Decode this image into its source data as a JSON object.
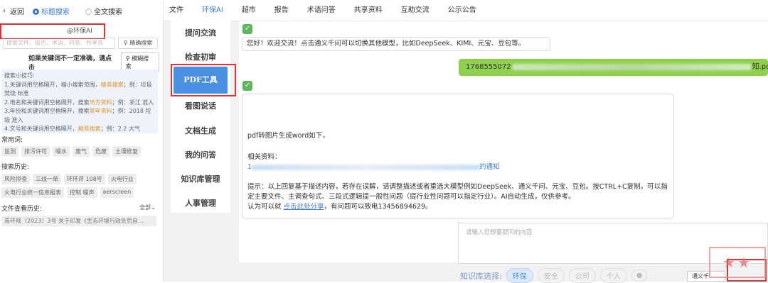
{
  "left_panel": {
    "back_label": "返回",
    "title_search_label": "标题搜索",
    "fulltext_search_label": "全文搜索",
    "keyword_box_text": "@环保AI",
    "search_placeholder": "搜索文件、报告、术语、问答、共享资",
    "precise_search_label": "精确搜索",
    "fuzzy_prompt": "如果关键词不一定准确，请点击",
    "fuzzy_search_label": "模糊搜索",
    "tips": {
      "title": "搜索小技巧:",
      "line1a": "1.关键词用空格隔开，缩小搜索范围，",
      "line1hl": "精准搜索",
      "line1b": "；例：垃圾 焚烧 标准",
      "line2a": "2.地名和关键词用空格隔开，搜索",
      "line2hl": "地方资料",
      "line2b": "；例：浙江 准入",
      "line3a": "3.年份和关键词用空格隔开，搜索",
      "line3hl": "某年资料",
      "line3b": "；例：2018 垃圾 准入",
      "line4a": "4.文号和关键词用空格隔开，",
      "line4hl": "精准搜索",
      "line4b": "；例：2.2 大气"
    },
    "common_words_label": "常用词:",
    "common_words": [
      "监测",
      "排污许可",
      "噪水",
      "废气",
      "危废",
      "土壤修复"
    ],
    "search_history_label": "搜索历史:",
    "search_history": [
      "风险排查",
      "三线一单",
      "环环评 108号",
      "火电行业",
      "火电行业统一信息报表",
      "控制 噪声",
      "aerscreen"
    ],
    "file_history_label": "文件查看历史:",
    "all_label": "全部",
    "file_history_item": "青环规〔2023〕3号 关于印发《生态环境行政处罚自..."
  },
  "nav": {
    "items": [
      "文件",
      "环保AI",
      "超市",
      "报告",
      "术语问答",
      "共享资料",
      "互助交流",
      "公示公告"
    ],
    "active_index": 1
  },
  "side_menu": {
    "items": [
      "提问交流",
      "检查初审",
      "PDF工具",
      "看图说话",
      "文档生成",
      "我的问答",
      "知识库管理",
      "人事管理"
    ],
    "active_index": 2
  },
  "chat": {
    "greeting": "您好！欢迎交流！点击通义千问可以切换其他模型，比如DeepSeek、KIMI、元宝、豆包等。",
    "user_prefix": "1768555072",
    "user_suffix": "知.pdf",
    "reply_line1": "pdf转图片生成word如下，",
    "reply_line2": "相关资料：",
    "reply_link_prefix": "1",
    "reply_link_suffix": "的通知",
    "reply_note": "提示：以上回复基于描述内容，若存在误解，请调整描述或者重选大模型例如DeepSeek、通义千问、元宝、豆包。按CTRL+C复制。可以指定主要文件、主调查句式、三段式逻辑提一般性问题（提行业性问题可以指定行业）。AI自动生成，仅供参考。",
    "reply_share_a": "认为可以就 ",
    "reply_share_link": "点击此处分享",
    "reply_share_b": "，有问题可以致电13456894629。",
    "input_placeholder": "请输入您想要提问的内容"
  },
  "knowledge_base": {
    "label": "知识库选择:",
    "chips": [
      "环保",
      "安全",
      "公司",
      "个人"
    ],
    "active_index": 0,
    "model_label": "通义千"
  },
  "colors": {
    "accent": "#3a7bd5",
    "highlight_box": "#dd3333",
    "user_bubble": "#8fd14f",
    "bot_icon": "#5cb85c"
  }
}
